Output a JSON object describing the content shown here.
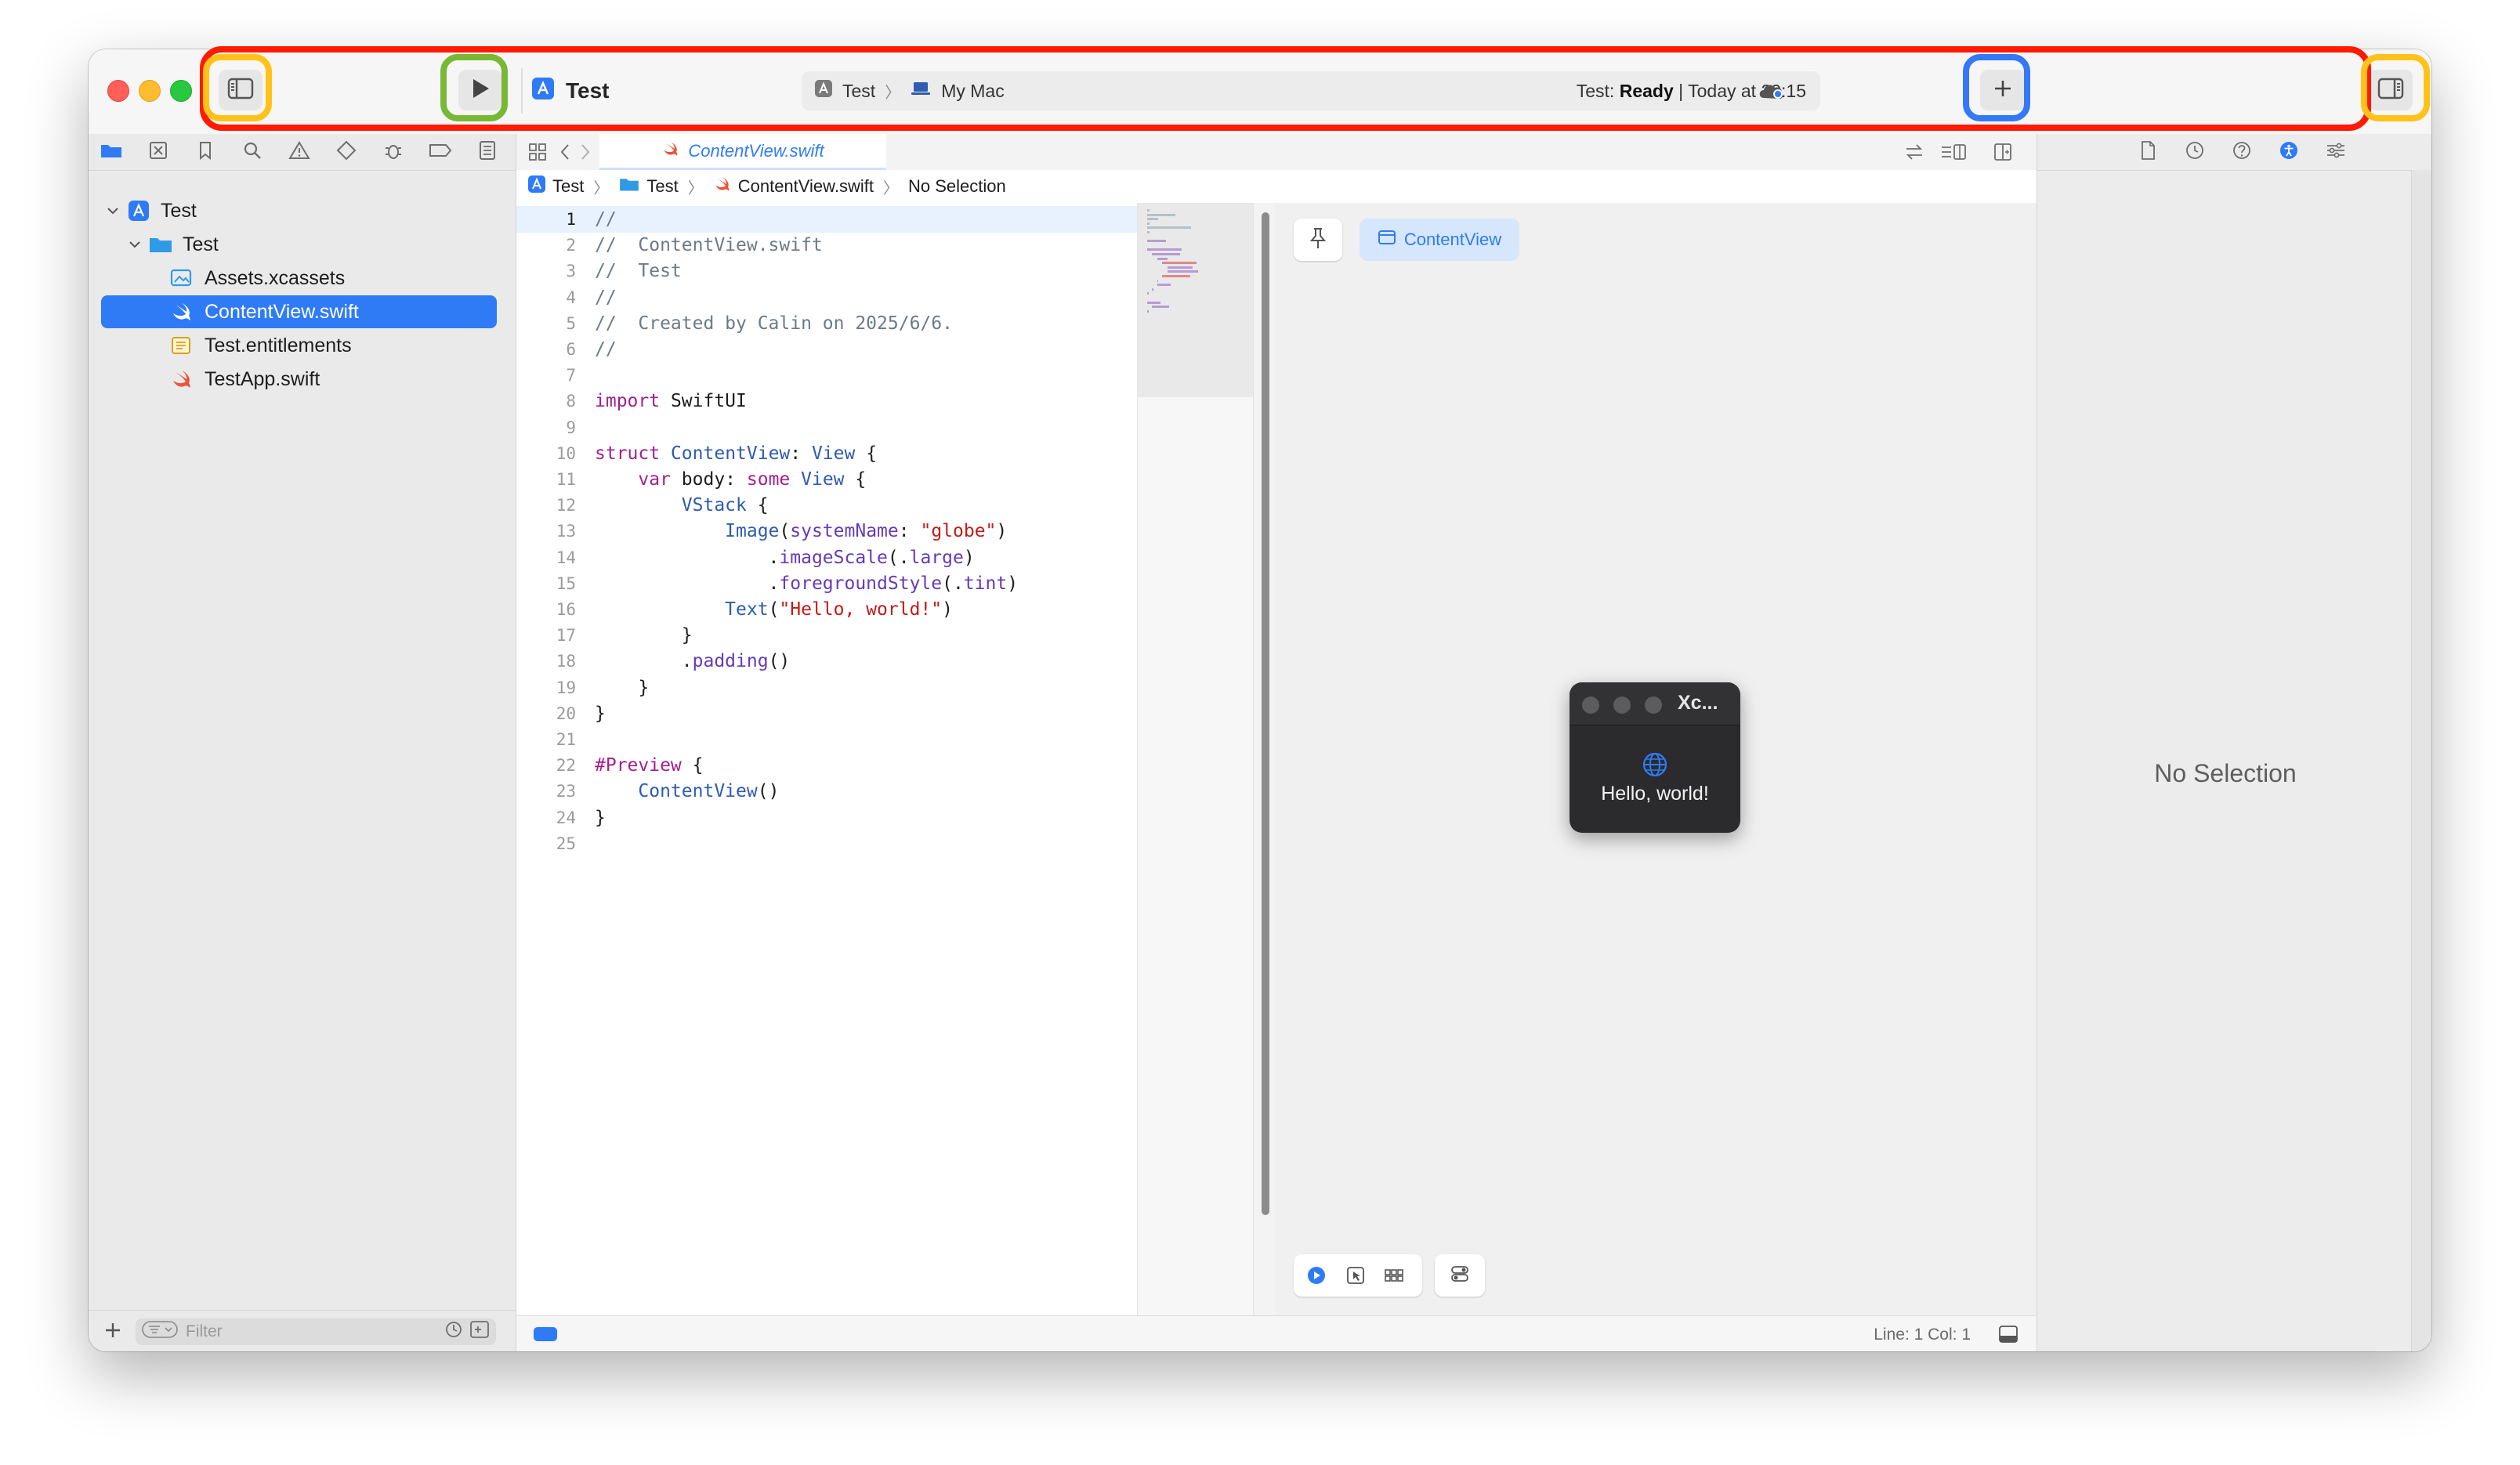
{
  "window": {
    "title": "Test",
    "scheme_target": "Test",
    "scheme_destination": "My Mac",
    "status_prefix": "Test: ",
    "status_state": "Ready",
    "status_suffix": " | Today at 20:15"
  },
  "navigator": {
    "tree": [
      {
        "label": "Test",
        "kind": "project",
        "depth": 0,
        "expanded": true
      },
      {
        "label": "Test",
        "kind": "folder",
        "depth": 1,
        "expanded": true
      },
      {
        "label": "Assets.xcassets",
        "kind": "assets",
        "depth": 2
      },
      {
        "label": "ContentView.swift",
        "kind": "swift",
        "depth": 2,
        "selected": true
      },
      {
        "label": "Test.entitlements",
        "kind": "entitlements",
        "depth": 2
      },
      {
        "label": "TestApp.swift",
        "kind": "swift",
        "depth": 2
      }
    ],
    "filter_placeholder": "Filter"
  },
  "editor": {
    "tab_label": "ContentView.swift",
    "breadcrumb": [
      "Test",
      "Test",
      "ContentView.swift",
      "No Selection"
    ],
    "current_line": 1,
    "code_lines": [
      "//",
      "//  ContentView.swift",
      "//  Test",
      "//",
      "//  Created by Calin on 2025/6/6.",
      "//",
      "",
      "import SwiftUI",
      "",
      "struct ContentView: View {",
      "    var body: some View {",
      "        VStack {",
      "            Image(systemName: \"globe\")",
      "                .imageScale(.large)",
      "                .foregroundStyle(.tint)",
      "            Text(\"Hello, world!\")",
      "        }",
      "        .padding()",
      "    }",
      "}",
      "",
      "#Preview {",
      "    ContentView()",
      "}",
      ""
    ],
    "status_line": "Line: 1  Col: 1"
  },
  "preview": {
    "chip_label": "ContentView",
    "window_title": "Xc...",
    "content_text": "Hello, world!"
  },
  "inspector": {
    "empty_text": "No Selection"
  },
  "colors": {
    "accent": "#2f7bf5",
    "highlight_red": "#ff1a00",
    "highlight_yellow": "#ffc21a",
    "highlight_green": "#78b835",
    "highlight_blue": "#3478f6",
    "swift_orange": "#f05138"
  },
  "icons": {
    "toolbar": [
      "sidebar-toggle-icon",
      "play-icon",
      "plus-icon",
      "inspector-toggle-icon",
      "cloud-icon"
    ],
    "navigator_tabs": [
      "folder-icon",
      "source-control-icon",
      "bookmark-icon",
      "search-icon",
      "warning-icon",
      "test-icon",
      "debug-icon",
      "breakpoint-icon",
      "report-icon"
    ],
    "inspector_tabs": [
      "file-icon",
      "history-icon",
      "help-icon",
      "accessibility-icon",
      "attributes-icon"
    ]
  }
}
